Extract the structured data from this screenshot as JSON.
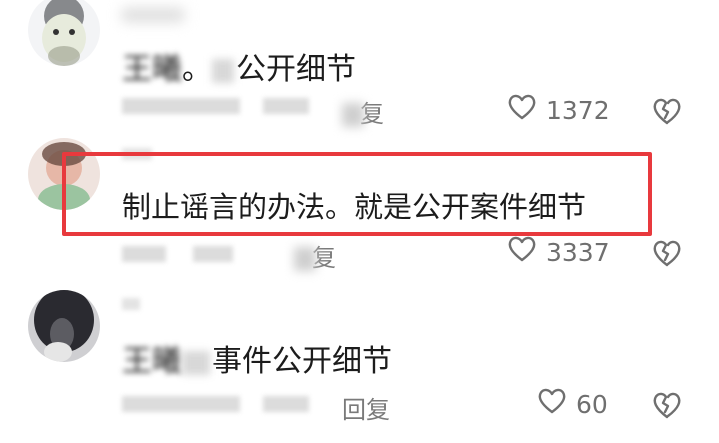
{
  "comments": [
    {
      "username": "",
      "text_blurred": "王曦",
      "text_separator": "。",
      "text_clear": "公开细节",
      "meta": "",
      "reply": "复",
      "likes": "1372"
    },
    {
      "username": "",
      "text_clear": "制止谣言的办法。就是公开案件细节",
      "meta": "",
      "reply": "复",
      "likes": "3337"
    },
    {
      "username": "",
      "text_blurred": "王曦",
      "text_clear": "事件公开细节",
      "meta": "",
      "reply": "回复",
      "likes": "60"
    }
  ],
  "icons": [
    "heart-outline-icon",
    "broken-heart-icon"
  ],
  "colors": {
    "highlight": "#e8393d",
    "text": "#1c1c1c",
    "muted": "#6f6f6f"
  }
}
